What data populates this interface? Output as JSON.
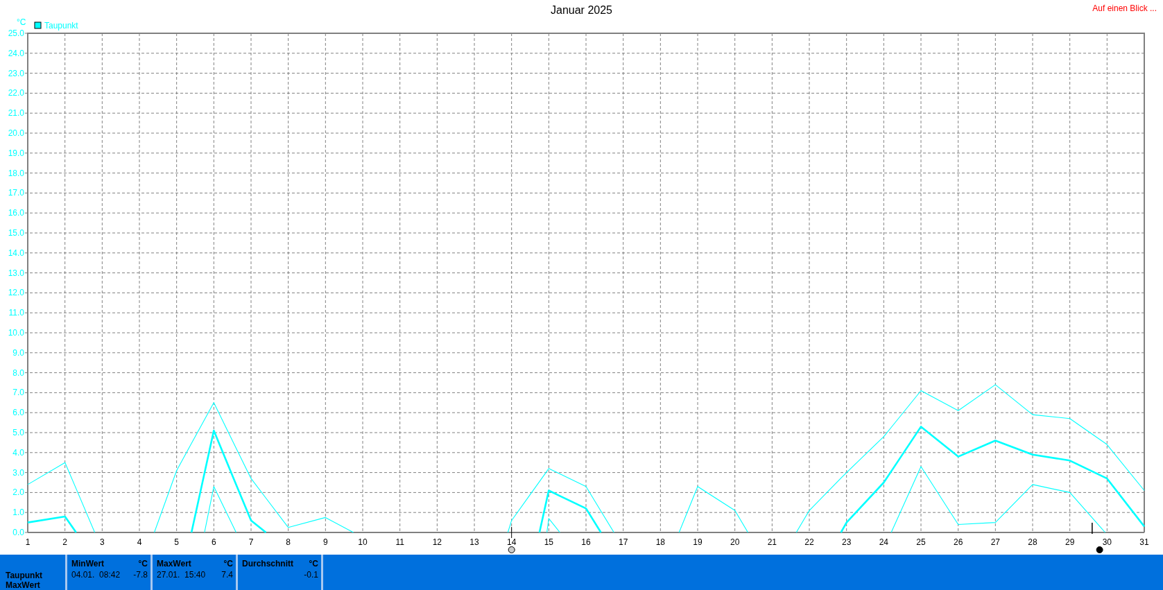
{
  "title": "Januar 2025",
  "overview_link": "Auf einen Blick ...",
  "chart": {
    "chart_data": {
      "type": "line",
      "ylabel": "°C",
      "grid": true,
      "x": [
        1,
        2,
        2.3,
        2.8,
        4.4,
        5,
        5.4,
        5.75,
        6,
        6.6,
        7,
        7.4,
        8,
        9,
        9.75,
        13.9,
        14,
        14.75,
        14.95,
        15,
        15.3,
        16,
        16.4,
        16.75,
        18.5,
        19,
        20,
        20.35,
        21.65,
        22,
        22.85,
        23,
        24,
        24.2,
        25,
        26,
        27,
        28,
        29,
        29.95,
        30,
        31
      ],
      "xticks": [
        1,
        2,
        3,
        4,
        5,
        6,
        7,
        8,
        9,
        10,
        11,
        12,
        13,
        14,
        15,
        16,
        17,
        18,
        19,
        20,
        21,
        22,
        23,
        24,
        25,
        26,
        27,
        28,
        29,
        30,
        31
      ],
      "yticks": [
        {
          "value": 0,
          "label": "0.0"
        },
        {
          "value": 1,
          "label": "1.0"
        },
        {
          "value": 2,
          "label": "2.0"
        },
        {
          "value": 3,
          "label": "3.0"
        },
        {
          "value": 4,
          "label": "4.0"
        },
        {
          "value": 5,
          "label": "5.0"
        },
        {
          "value": 6,
          "label": "6.0"
        },
        {
          "value": 7,
          "label": "7.0"
        },
        {
          "value": 8,
          "label": "8.0"
        },
        {
          "value": 9,
          "label": "9.0"
        },
        {
          "value": 10,
          "label": "10.0"
        },
        {
          "value": 11,
          "label": "11.0"
        },
        {
          "value": 12,
          "label": "12.0"
        },
        {
          "value": 13,
          "label": "13.0"
        },
        {
          "value": 14,
          "label": "14.0"
        },
        {
          "value": 15,
          "label": "15.0"
        },
        {
          "value": 16,
          "label": "16.0"
        },
        {
          "value": 17,
          "label": "17.0"
        },
        {
          "value": 18,
          "label": "18.0"
        },
        {
          "value": 19,
          "label": "19.0"
        },
        {
          "value": 20,
          "label": "20.0"
        },
        {
          "value": 21,
          "label": "21.0"
        },
        {
          "value": 22,
          "label": "22.0"
        },
        {
          "value": 23,
          "label": "23.0"
        },
        {
          "value": 24,
          "label": "24.0"
        },
        {
          "value": 25,
          "label": "25.0"
        }
      ],
      "xlim": [
        1,
        31
      ],
      "ylim": [
        0,
        25
      ],
      "series": [
        {
          "color": "#00ffff",
          "values": [
            2.4,
            3.5,
            2.19,
            0,
            0,
            3.1,
            4.46,
            5.65,
            6.5,
            4.22,
            2.7,
            1.72,
            0.25,
            0.75,
            0,
            0,
            0.6,
            2.55,
            3.07,
            3.2,
            2.93,
            2.3,
            1.07,
            0,
            0,
            2.3,
            1.1,
            0,
            0,
            1.1,
            2.72,
            3.0,
            4.8,
            5.26,
            7.1,
            6.1,
            7.4,
            5.9,
            5.7,
            4.47,
            4.4,
            2.1
          ]
        },
        {
          "name": "Taupunkt",
          "color": "#00ffff",
          "values": [
            0.5,
            0.8,
            0,
            null,
            null,
            null,
            0,
            2.98,
            5.1,
            2.4,
            0.6,
            0,
            null,
            null,
            null,
            null,
            null,
            0,
            1.68,
            2.1,
            1.83,
            1.2,
            0,
            null,
            null,
            null,
            null,
            null,
            null,
            null,
            0,
            0.5,
            2.5,
            3.06,
            5.3,
            3.8,
            4.6,
            3.9,
            3.6,
            2.75,
            2.7,
            0.3
          ]
        },
        {
          "color": "#00ffff",
          "values": [
            null,
            null,
            null,
            null,
            null,
            null,
            null,
            0,
            2.3,
            0,
            null,
            null,
            null,
            null,
            null,
            null,
            null,
            null,
            0,
            0.7,
            0,
            null,
            null,
            null,
            null,
            null,
            null,
            null,
            null,
            null,
            null,
            null,
            null,
            0,
            3.3,
            0.4,
            0.5,
            2.4,
            2.0,
            0,
            null,
            null
          ]
        }
      ]
    }
  },
  "footer": {
    "row_labels": [
      "Taupunkt",
      "MaxWert"
    ],
    "stats": [
      {
        "label": "MinWert",
        "unit": "°C",
        "time": "04.01.  08:42",
        "value": "-7.8"
      },
      {
        "label": "MaxWert",
        "unit": "°C",
        "time": "27.01.  15:40",
        "value": "7.4"
      },
      {
        "label": "Durchschnitt",
        "unit": "°C",
        "value": "-0.1"
      }
    ]
  }
}
